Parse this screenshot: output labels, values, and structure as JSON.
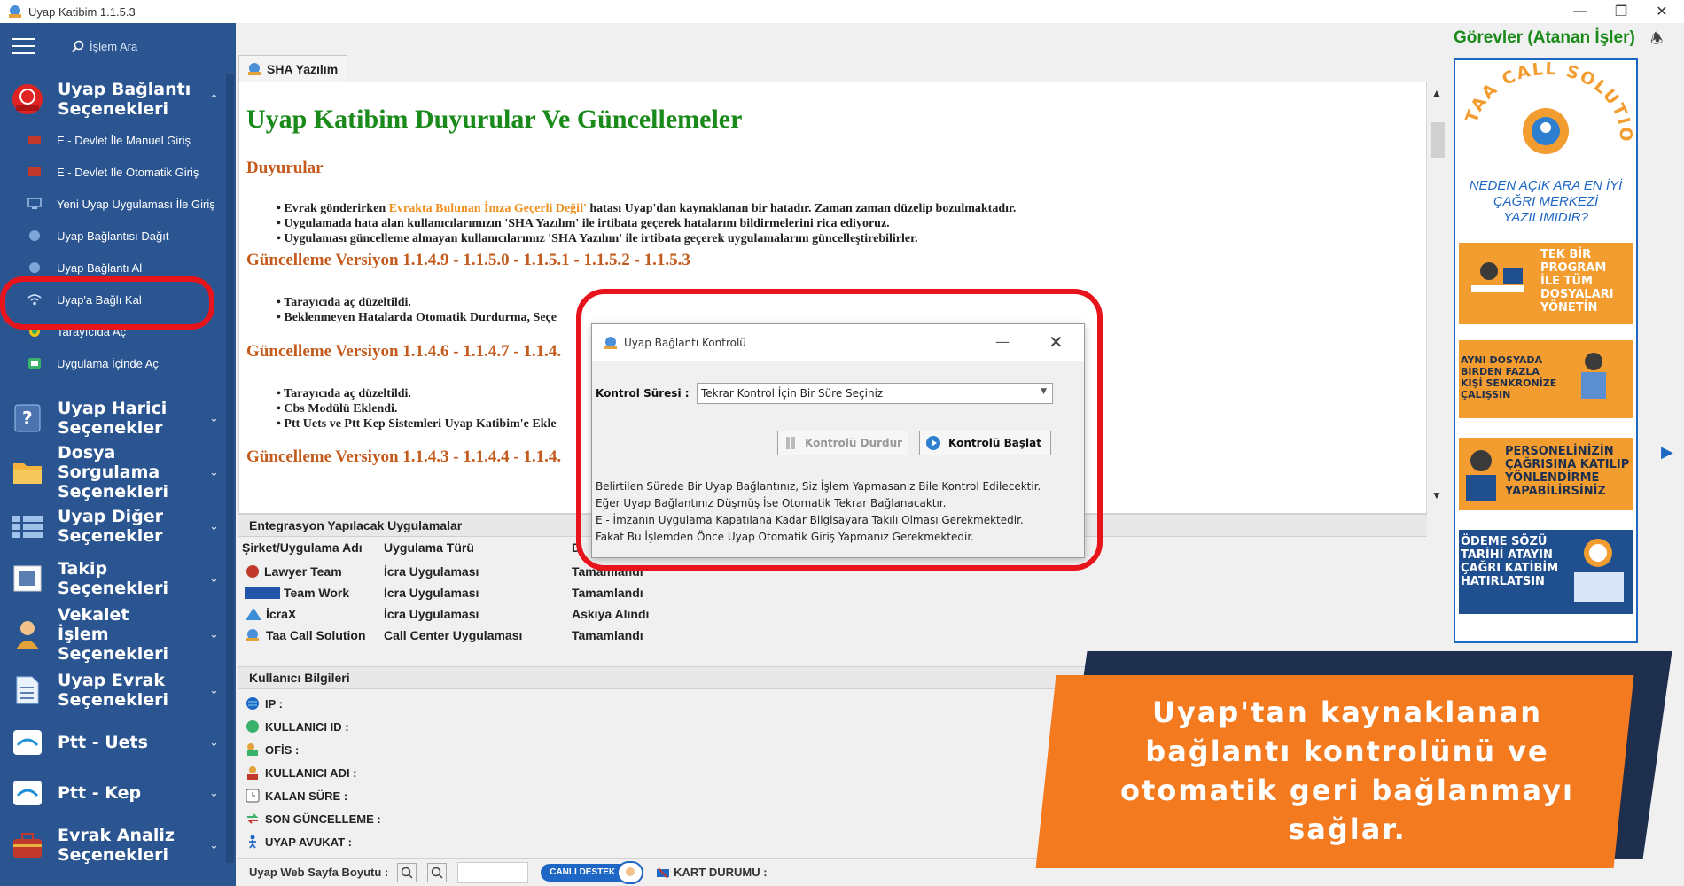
{
  "window": {
    "title": "Uyap Katibim 1.1.5.3"
  },
  "sidebar": {
    "search_placeholder": "İşlem Ara",
    "groups": [
      {
        "label": "Uyap Bağlantı Seçenekleri"
      },
      {
        "label": "Uyap Harici Seçenekler"
      },
      {
        "label": "Dosya Sorgulama Seçenekleri"
      },
      {
        "label": "Uyap Diğer Seçenekler"
      },
      {
        "label": "Takip Seçenekleri"
      },
      {
        "label": "Vekalet İşlem Seçenekleri"
      },
      {
        "label": "Uyap Evrak Seçenekleri"
      },
      {
        "label": "Ptt - Uets"
      },
      {
        "label": "Ptt - Kep"
      },
      {
        "label": "Evrak Analiz Seçenekleri"
      }
    ],
    "subitems": [
      {
        "label": "E - Devlet İle Manuel Giriş"
      },
      {
        "label": "E - Devlet İle Otomatik Giriş"
      },
      {
        "label": "Yeni Uyap Uygulaması İle Giriş"
      },
      {
        "label": "Uyap Bağlantısı Dağıt"
      },
      {
        "label": "Uyap Bağlantı Al"
      },
      {
        "label": "Uyap'a Bağlı Kal"
      },
      {
        "label": "Tarayıcıda Aç"
      },
      {
        "label": "Uygulama İçinde Aç"
      }
    ]
  },
  "tab": {
    "label": "SHA Yazılım"
  },
  "content": {
    "title": "Uyap Katibim Duyurular Ve Güncellemeler",
    "announcements_heading": "Duyurular",
    "announcements": {
      "a1_pre": "Evrak gönderirken ",
      "a1_hl": "Evrakta Bulunan İmza Geçerli Değil'",
      "a1_post": " hatası Uyap'dan kaynaklanan bir hatadır. Zaman zaman düzelip bozulmaktadır.",
      "a2": "Uygulamada hata alan kullanıcılarımızın 'SHA Yazılım' ile irtibata geçerek hatalarını bildirmelerini rica ediyoruz.",
      "a3": "Uygulaması güncelleme almayan kullanıcılarımız 'SHA Yazılım' ile irtibata geçerek uygulamalarını güncelleştirebilirler."
    },
    "updates": [
      {
        "heading": "Güncelleme Versiyon 1.1.4.9 - 1.1.5.0 - 1.1.5.1 - 1.1.5.2 - 1.1.5.3",
        "items": [
          "Tarayıcıda aç düzeltildi.",
          "Beklenmeyen Hatalarda Otomatik Durdurma, Seçe"
        ]
      },
      {
        "heading": "Güncelleme Versiyon 1.1.4.6 - 1.1.4.7 - 1.1.4.",
        "items": [
          "Tarayıcıda aç düzeltildi.",
          "Cbs Modülü Eklendi.",
          "Ptt Uets ve Ptt Kep Sistemleri Uyap Katibim'e Ekle"
        ]
      },
      {
        "heading": "Güncelleme Versiyon 1.1.4.3 - 1.1.4.4 - 1.1.4.",
        "items": []
      }
    ]
  },
  "integration": {
    "heading": "Entegrasyon Yapılacak Uygulamalar",
    "columns": [
      "Şirket/Uygulama Adı",
      "Uygulama Türü",
      "D"
    ],
    "rows": [
      {
        "name": "Lawyer Team",
        "type": "İcra Uygulaması",
        "status": "Tamamlandı"
      },
      {
        "name": "Team Work",
        "type": "İcra Uygulaması",
        "status": "Tamamlandı"
      },
      {
        "name": "İcraX",
        "type": "İcra Uygulaması",
        "status": "Askıya Alındı"
      },
      {
        "name": "Taa Call Solution",
        "type": "Call Center Uygulaması",
        "status": "Tamamlandı"
      }
    ]
  },
  "user_info": {
    "heading": "Kullanıcı Bilgileri",
    "fields": [
      "IP :",
      "KULLANICI ID :",
      "OFİS :",
      "KULLANICI ADI :",
      "KALAN SÜRE :",
      "SON GÜNCELLEME :",
      "UYAP AVUKAT :"
    ]
  },
  "bottom_bar": {
    "page_size_label": "Uyap Web Sayfa Boyutu :",
    "live_support": "CANLI DESTEK",
    "card_status": "KART DURUMU :"
  },
  "right_panel": {
    "title": "Görevler (Atanan İşler)",
    "ad": {
      "brand": "TAA CALL SOLUTION",
      "question": "NEDEN AÇIK ARA EN İYİ ÇAĞRI MERKEZİ YAZILIMIDIR?",
      "b1": "TEK BİR PROGRAM İLE TÜM DOSYALARI YÖNETİN",
      "b2": "AYNI DOSYADA BİRDEN FAZLA KİŞİ SENKRONİZE ÇALIŞSIN",
      "b3": "PERSONELİNİZİN ÇAĞRISINA KATILIP YÖNLENDİRME YAPABİLİRSİNİZ",
      "b4": "ÖDEME SÖZÜ TARİHİ ATAYIN ÇAĞRI KATİBİM HATIRLATSIN"
    }
  },
  "dialog": {
    "title": "Uyap Bağlantı Kontrolü",
    "label": "Kontrol Süresi :",
    "select_value": "Tekrar Kontrol İçin Bir Süre Seçiniz",
    "stop_button": "Kontrolü Durdur",
    "start_button": "Kontrolü Başlat",
    "info": [
      "Belirtilen Sürede Bir Uyap Bağlantınız, Siz İşlem Yapmasanız Bile Kontrol Edilecektir.",
      "Eğer Uyap Bağlantınız Düşmüş İse Otomatik Tekrar Bağlanacaktır.",
      "E - İmzanın Uygulama Kapatılana Kadar Bilgisayara Takılı Olması Gerekmektedir.",
      "Fakat Bu İşlemden Önce Uyap Otomatik Giriş Yapmanız Gerekmektedir."
    ]
  },
  "banner": {
    "text": "Uyap'tan kaynaklanan bağlantı kontrolünü ve otomatik geri bağlanmayı sağlar."
  },
  "colors": {
    "sidebar": "#2a5591",
    "accent_green": "#1a8a1a",
    "heading_orange": "#c45a1b",
    "highlight_red": "#e8141b",
    "banner_orange": "#f47a20",
    "banner_navy": "#1d2f4d"
  }
}
